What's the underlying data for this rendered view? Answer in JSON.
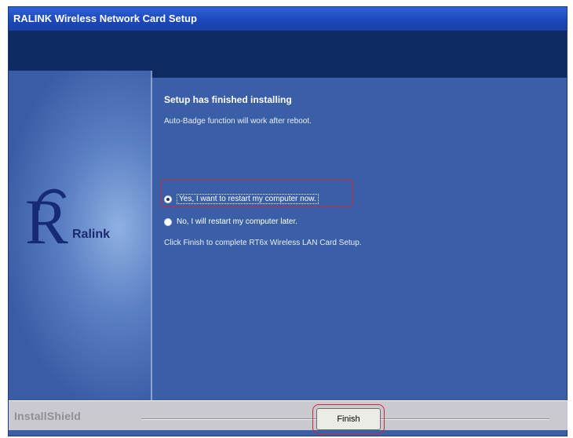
{
  "window": {
    "title": "RALINK Wireless Network Card Setup"
  },
  "main": {
    "heading": "Setup has finished installing",
    "subtext": "Auto-Badge function will work after reboot.",
    "options": [
      {
        "label": "Yes, I want to restart my computer now.",
        "selected": true
      },
      {
        "label": "No, I will restart my computer later.",
        "selected": false
      }
    ],
    "info": "Click Finish to complete RT6x Wireless LAN Card Setup."
  },
  "logo": {
    "letter": "R",
    "text": "Ralink"
  },
  "footer": {
    "brand": "InstallShield",
    "finish_label": "Finish"
  },
  "colors": {
    "highlight": "#c8283a",
    "panel": "#3c5fa6",
    "banner": "#0e2a63"
  }
}
